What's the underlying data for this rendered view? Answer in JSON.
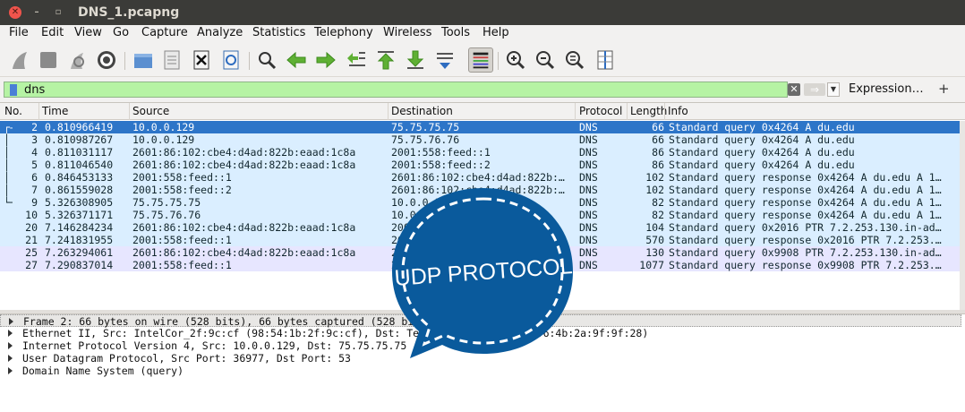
{
  "window": {
    "title": "DNS_1.pcapng"
  },
  "menu": [
    {
      "label": "File"
    },
    {
      "label": "Edit"
    },
    {
      "label": "View"
    },
    {
      "label": "Go"
    },
    {
      "label": "Capture"
    },
    {
      "label": "Analyze"
    },
    {
      "label": "Statistics"
    },
    {
      "label": "Telephony"
    },
    {
      "label": "Wireless"
    },
    {
      "label": "Tools"
    },
    {
      "label": "Help"
    }
  ],
  "toolbar": {
    "icons": [
      "shark-fin-start-icon",
      "stop-square-icon",
      "restart-capture-icon",
      "capture-options-gear-icon",
      "open-folder-icon",
      "save-file-icon",
      "close-file-icon",
      "reload-icon",
      "find-packet-icon",
      "go-back-icon",
      "go-forward-icon",
      "go-to-packet-icon",
      "go-first-icon",
      "go-last-icon",
      "autoscroll-icon",
      "colorize-icon",
      "zoom-in-icon",
      "zoom-out-icon",
      "normal-size-icon",
      "resize-columns-icon"
    ]
  },
  "filter": {
    "value": "dns",
    "expression_label": "Expression…",
    "add_label": "+",
    "field_color": "#b6f3a4"
  },
  "packet_list": {
    "columns": [
      "No.",
      "Time",
      "Source",
      "Destination",
      "Protocol",
      "Length",
      "Info"
    ],
    "rows": [
      {
        "no": "2",
        "time": "0.810966419",
        "src": "10.0.0.129",
        "dst": "75.75.75.75",
        "proto": "DNS",
        "len": "66",
        "info": "Standard query 0x4264 A du.edu",
        "style": "sel",
        "mark": "┌→"
      },
      {
        "no": "3",
        "time": "0.810987267",
        "src": "10.0.0.129",
        "dst": "75.75.76.76",
        "proto": "DNS",
        "len": "66",
        "info": "Standard query 0x4264 A du.edu",
        "style": "",
        "mark": "│"
      },
      {
        "no": "4",
        "time": "0.811031117",
        "src": "2601:86:102:cbe4:d4ad:822b:eaad:1c8a",
        "dst": "2001:558:feed::1",
        "proto": "DNS",
        "len": "86",
        "info": "Standard query 0x4264 A du.edu",
        "style": "",
        "mark": "│"
      },
      {
        "no": "5",
        "time": "0.811046540",
        "src": "2601:86:102:cbe4:d4ad:822b:eaad:1c8a",
        "dst": "2001:558:feed::2",
        "proto": "DNS",
        "len": "86",
        "info": "Standard query 0x4264 A du.edu",
        "style": "",
        "mark": "│"
      },
      {
        "no": "6",
        "time": "0.846453133",
        "src": "2001:558:feed::1",
        "dst": "2601:86:102:cbe4:d4ad:822b:…",
        "proto": "DNS",
        "len": "102",
        "info": "Standard query response 0x4264 A du.edu A 1…",
        "style": "",
        "mark": "│"
      },
      {
        "no": "7",
        "time": "0.861559028",
        "src": "2001:558:feed::2",
        "dst": "2601:86:102:cbe4:d4ad:822b:…",
        "proto": "DNS",
        "len": "102",
        "info": "Standard query response 0x4264 A du.edu A 1…",
        "style": "",
        "mark": "│"
      },
      {
        "no": "9",
        "time": "5.326308905",
        "src": "75.75.75.75",
        "dst": "10.0.0.129",
        "proto": "DNS",
        "len": "82",
        "info": "Standard query response 0x4264 A du.edu A 1…",
        "style": "",
        "mark": "└─"
      },
      {
        "no": "10",
        "time": "5.326371171",
        "src": "75.75.76.76",
        "dst": "10.0.0.129",
        "proto": "DNS",
        "len": "82",
        "info": "Standard query response 0x4264 A du.edu A 1…",
        "style": "",
        "mark": ""
      },
      {
        "no": "20",
        "time": "7.146284234",
        "src": "2601:86:102:cbe4:d4ad:822b:eaad:1c8a",
        "dst": "2001:558:feed::1",
        "proto": "DNS",
        "len": "104",
        "info": "Standard query 0x2016 PTR 7.2.253.130.in-ad…",
        "style": "",
        "mark": ""
      },
      {
        "no": "21",
        "time": "7.241831955",
        "src": "2001:558:feed::1",
        "dst": "2601:86:102:cbe4:d4ad:822b:…",
        "proto": "DNS",
        "len": "570",
        "info": "Standard query response 0x2016 PTR 7.2.253.…",
        "style": "",
        "mark": ""
      },
      {
        "no": "25",
        "time": "7.263294061",
        "src": "2601:86:102:cbe4:d4ad:822b:eaad:1c8a",
        "dst": "2001:558:feed::1",
        "proto": "DNS",
        "len": "130",
        "info": "Standard query 0x9908 PTR 7.2.253.130.in-ad…",
        "style": "alt",
        "mark": ""
      },
      {
        "no": "27",
        "time": "7.290837014",
        "src": "2001:558:feed::1",
        "dst": "2601:86:102:cbe4:d4ad:822b:…",
        "proto": "DNS",
        "len": "1077",
        "info": "Standard query response 0x9908 PTR 7.2.253.…",
        "style": "alt",
        "mark": ""
      }
    ],
    "colors": {
      "row": "#daeeff",
      "selected": "#2d75c8",
      "alt": "#e7e6ff"
    }
  },
  "details": {
    "rows": [
      {
        "text": "Frame 2: 66 bytes on wire (528 bits), 66 bytes captured (528 bits) on interface 0",
        "style": "sel"
      },
      {
        "text": "Ethernet II, Src: IntelCor_2f:9c:cf (98:54:1b:2f:9c:cf), Dst: Technico_4b:2a:9f (e4:6:4b:2a:9f:9f:28)",
        "style": ""
      },
      {
        "text": "Internet Protocol Version 4, Src: 10.0.0.129, Dst: 75.75.75.75",
        "style": ""
      },
      {
        "text": "User Datagram Protocol, Src Port: 36977, Dst Port: 53",
        "style": ""
      },
      {
        "text": "Domain Name System (query)",
        "style": ""
      }
    ]
  },
  "sticker": {
    "text": "UDP PROTOCOL",
    "color": "#0a5a9c"
  }
}
